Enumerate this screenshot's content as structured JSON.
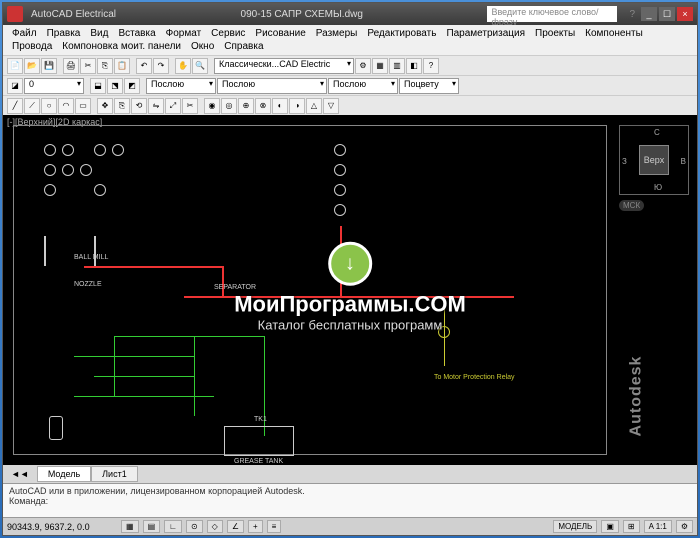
{
  "titlebar": {
    "app": "AutoCAD Electrical",
    "file": "090-15 САПР СХЕМЫ.dwg",
    "search_placeholder": "Введите ключевое слово/фразу",
    "min": "_",
    "max": "☐",
    "close": "×"
  },
  "menu": {
    "items": [
      "Файл",
      "Правка",
      "Вид",
      "Вставка",
      "Формат",
      "Сервис",
      "Рисование",
      "Размеры",
      "Редактировать",
      "Параметризация",
      "Проекты",
      "Компоненты",
      "Провода",
      "Компоновка моит. панели",
      "Окно",
      "Справка"
    ]
  },
  "toolbar2": {
    "workspace": "Классически...CAD Electric"
  },
  "toolbar3": {
    "layer_combo1": "Послою",
    "layer_combo2": "Послою",
    "layer_combo3": "Послою",
    "linewt": "Поцвету"
  },
  "viewport": {
    "label": "[-][Верхний][2D каркас]"
  },
  "viewcube": {
    "face": "Верх",
    "n": "С",
    "s": "Ю",
    "e": "В",
    "w": "З",
    "wcs": "МСК"
  },
  "drawing": {
    "grease_tank": "GREASE TANK",
    "tk1": "TK1",
    "motor_note": "To Motor Protection Relay",
    "ball_mill": "BALL MILL",
    "separator": "SEPARATOR",
    "nozzle": "NOZZLE"
  },
  "logo": {
    "text": "Autodesk"
  },
  "tabs": {
    "model": "Модель",
    "sheet1": "Лист1"
  },
  "cmdline": {
    "line1": "AutoCAD или в приложении, лицензированном корпорацией Autodesk.",
    "prompt": "Команда:"
  },
  "statusbar": {
    "coords": "90343.9, 9637.2, 0.0",
    "model_btn": "МОДЕЛЬ"
  },
  "watermark": {
    "title": "МоиПрограммы.COM",
    "subtitle": "Каталог бесплатных программ",
    "arrow": "↓"
  }
}
